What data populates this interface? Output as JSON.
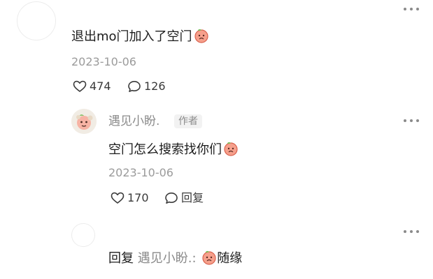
{
  "comment": {
    "text": "退出mo门加入了空门",
    "emoji_icon": "peach-face-emoji",
    "date": "2023-10-06",
    "likes": "474",
    "replies": "126"
  },
  "reply": {
    "username": "遇见小盼.",
    "badge": "作者",
    "text": "空门怎么搜索找你们",
    "emoji_icon": "peach-face-emoji",
    "date": "2023-10-06",
    "likes": "170",
    "reply_label": "回复"
  },
  "reply_input": {
    "prefix": "回复",
    "target": "遇见小盼.:",
    "emoji_icon": "peach-face-emoji",
    "text": "随缘"
  },
  "colors": {
    "text_primary": "#1c1c1c",
    "text_secondary": "#8a8a8a",
    "badge_bg": "#f2f2f2",
    "emoji_peach": "#f08a78"
  }
}
